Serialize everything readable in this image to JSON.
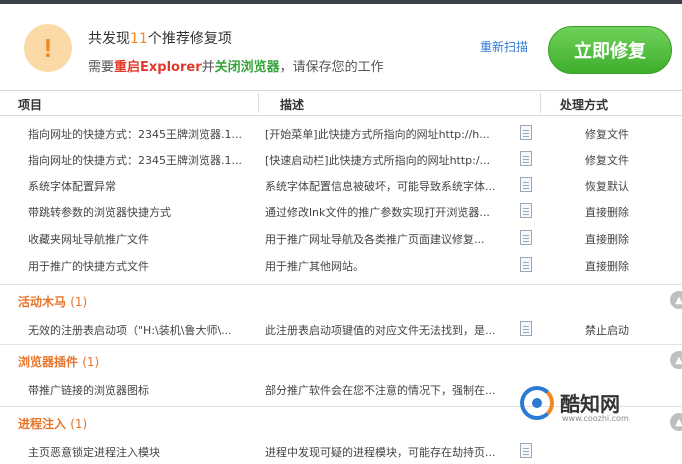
{
  "header": {
    "title_prefix": "共发现",
    "count": "11",
    "title_suffix": "个推荐修复项",
    "sub_prefix": "需要",
    "restart_label": "重启Explorer",
    "sub_mid": "并",
    "close_label": "关闭浏览器",
    "sub_suffix": "，请保存您的工作",
    "rescan_label": "重新扫描",
    "fix_label": "立即修复",
    "warning_glyph": "!"
  },
  "columns": {
    "item": "项目",
    "desc": "描述",
    "action": "处理方式"
  },
  "rows": [
    {
      "item": "指向网址的快捷方式：2345王牌浏览器.1...",
      "desc": "[开始菜单]此快捷方式所指向的网址http://h...",
      "action": "修复文件"
    },
    {
      "item": "指向网址的快捷方式：2345王牌浏览器.1...",
      "desc": "[快速启动栏]此快捷方式所指向的网址http:/...",
      "action": "修复文件"
    },
    {
      "item": "系统字体配置异常",
      "desc": "系统字体配置信息被破坏，可能导致系统字体...",
      "action": "恢复默认"
    },
    {
      "item": "带跳转参数的浏览器快捷方式",
      "desc": "通过修改lnk文件的推广参数实现打开浏览器...",
      "action": "直接删除"
    },
    {
      "item": "收藏夹网址导航推广文件",
      "desc": "用于推广网址导航及各类推广页面建议修复...",
      "action": "直接删除"
    },
    {
      "item": "用于推广的快捷方式文件",
      "desc": "用于推广其他网站。",
      "action": "直接删除"
    }
  ],
  "categories": [
    {
      "name": "活动木马",
      "count": "(1)",
      "row": {
        "item": "无效的注册表启动项（\"H:\\装机\\鲁大师\\...",
        "desc": "此注册表启动项键值的对应文件无法找到，是...",
        "action": "禁止启动"
      }
    },
    {
      "name": "浏览器插件",
      "count": "(1)",
      "row": {
        "item": "带推广链接的浏览器图标",
        "desc": "部分推广软件会在您不注意的情况下，强制在...",
        "action": ""
      }
    },
    {
      "name": "进程注入",
      "count": "(1)",
      "row": {
        "item": "主页恶意锁定进程注入模块",
        "desc": "进程中发现可疑的进程模块，可能存在劫持页...",
        "action": ""
      }
    }
  ],
  "watermark": {
    "name": "酷知网",
    "url": "www.coozhi.com"
  },
  "colors": {
    "accent_green": "#3fae2d",
    "link_blue": "#2f7cd6",
    "warn_orange": "#f08a24",
    "category_orange": "#e8742a"
  }
}
